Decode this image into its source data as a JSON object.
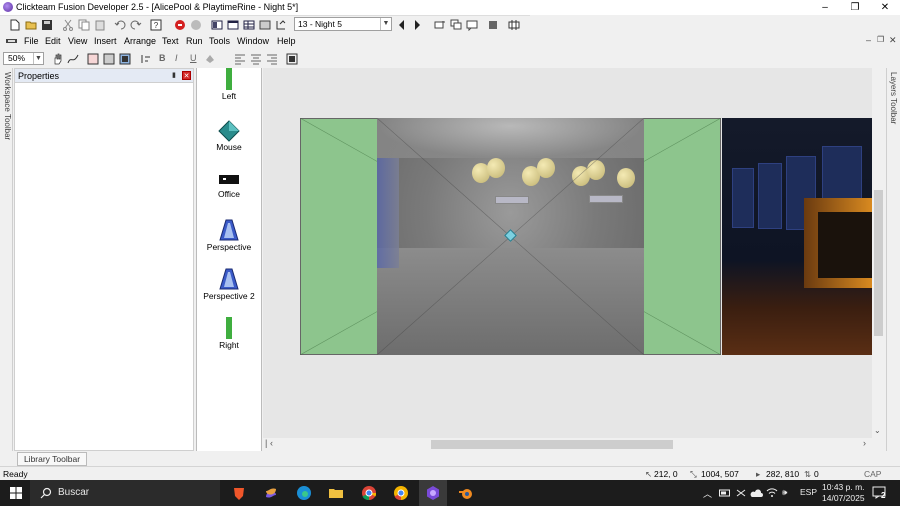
{
  "window": {
    "title": "Clickteam Fusion Developer 2.5 - [AlicePool & PlaytimeRine - Night 5*]",
    "min_label": "–",
    "max_label": "❐",
    "close_label": "✕"
  },
  "toolbar": {
    "frame_select_value": "13 - Night 5"
  },
  "menu": {
    "items": [
      "File",
      "Edit",
      "View",
      "Insert",
      "Arrange",
      "Text",
      "Run",
      "Tools",
      "Window",
      "Help"
    ]
  },
  "format_toolbar": {
    "zoom_value": "50%",
    "bold": "B",
    "italic": "I",
    "underline": "U"
  },
  "workspace_toolbar": {
    "label": "Workspace Toolbar"
  },
  "properties": {
    "title": "Properties"
  },
  "objects": [
    {
      "label": "Left",
      "icon": "green-bar-icon"
    },
    {
      "label": "Mouse",
      "icon": "teal-diamond-icon"
    },
    {
      "label": "Office",
      "icon": "black-bar-icon"
    },
    {
      "label": "Perspective",
      "icon": "perspective-icon"
    },
    {
      "label": "Perspective 2",
      "icon": "perspective-icon"
    },
    {
      "label": "Right",
      "icon": "green-bar-icon"
    }
  ],
  "layers_toolbar": {
    "label": "Layers Toolbar"
  },
  "library_toolbar": {
    "label": "Library Toolbar"
  },
  "status": {
    "ready": "Ready",
    "cursor_pos": "212, 0",
    "size": "1004, 507",
    "mouse_pos": "282, 810",
    "count": "0",
    "keys": "CAP NUM"
  },
  "taskbar": {
    "search_label": "Buscar",
    "language": "ESP",
    "time": "10:43 p. m.",
    "date": "14/07/2025",
    "notifications": "2"
  },
  "colors": {
    "frame_green": "#8dc58d",
    "editor_bg": "#e6e6e6",
    "taskbar_bg": "#1c1c1c"
  }
}
